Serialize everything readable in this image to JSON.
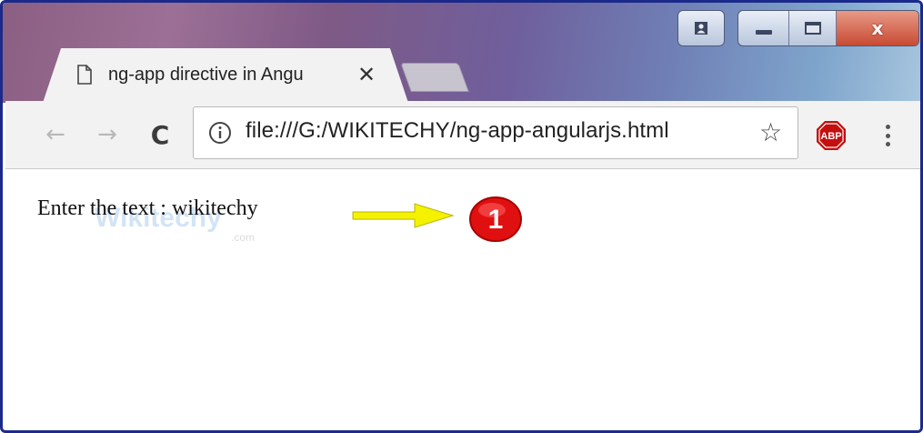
{
  "window": {
    "controls": {
      "user_icon": "user-icon",
      "minimize_icon": "minimize-icon",
      "maximize_icon": "maximize-icon",
      "close_glyph": "x"
    }
  },
  "tab": {
    "title": "ng-app directive in Angu",
    "close_glyph": "✕",
    "icon": "document-icon"
  },
  "toolbar": {
    "back_glyph": "←",
    "forward_glyph": "→",
    "reload_glyph": "C",
    "url": "file:///G:/WIKITECHY/ng-app-angularjs.html",
    "star_glyph": "☆",
    "abp_label": "ABP"
  },
  "page": {
    "text": "Enter the text : wikitechy",
    "annotation_number": "1",
    "watermark_text": "Wikitechy",
    "watermark_sub": ".com"
  },
  "colors": {
    "abp_red": "#c50e0e",
    "badge_red": "#e01010",
    "arrow_yellow": "#f4f200",
    "window_border": "#1b2a8a"
  }
}
